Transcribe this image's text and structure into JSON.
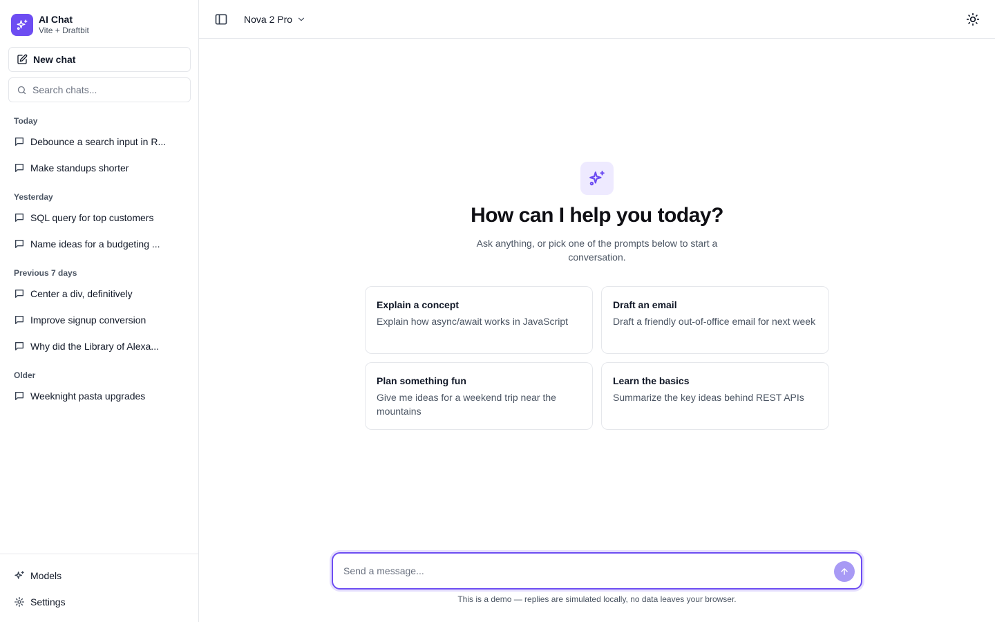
{
  "brand": {
    "title": "AI Chat",
    "subtitle": "Vite + Draftbit",
    "logo_icon": "sparkles-icon",
    "accent": "#6d4df2"
  },
  "sidebar": {
    "new_chat_label": "New chat",
    "search_placeholder": "Search chats...",
    "groups": [
      {
        "label": "Today",
        "items": [
          "Debounce a search input in R...",
          "Make standups shorter"
        ]
      },
      {
        "label": "Yesterday",
        "items": [
          "SQL query for top customers",
          "Name ideas for a budgeting ..."
        ]
      },
      {
        "label": "Previous 7 days",
        "items": [
          "Center a div, definitively",
          "Improve signup conversion",
          "Why did the Library of Alexa..."
        ]
      },
      {
        "label": "Older",
        "items": [
          "Weeknight pasta upgrades"
        ]
      }
    ],
    "bottom": {
      "models_label": "Models",
      "settings_label": "Settings"
    }
  },
  "header": {
    "model_name": "Nova 2 Pro"
  },
  "hero": {
    "title": "How can I help you today?",
    "subtitle": "Ask anything, or pick one of the prompts below to start a conversation."
  },
  "prompts": [
    {
      "title": "Explain a concept",
      "desc": "Explain how async/await works in JavaScript"
    },
    {
      "title": "Draft an email",
      "desc": "Draft a friendly out-of-office email for next week"
    },
    {
      "title": "Plan something fun",
      "desc": "Give me ideas for a weekend trip near the mountains"
    },
    {
      "title": "Learn the basics",
      "desc": "Summarize the key ideas behind REST APIs"
    }
  ],
  "composer": {
    "placeholder": "Send a message...",
    "disclaimer": "This is a demo — replies are simulated locally, no data leaves your browser."
  }
}
